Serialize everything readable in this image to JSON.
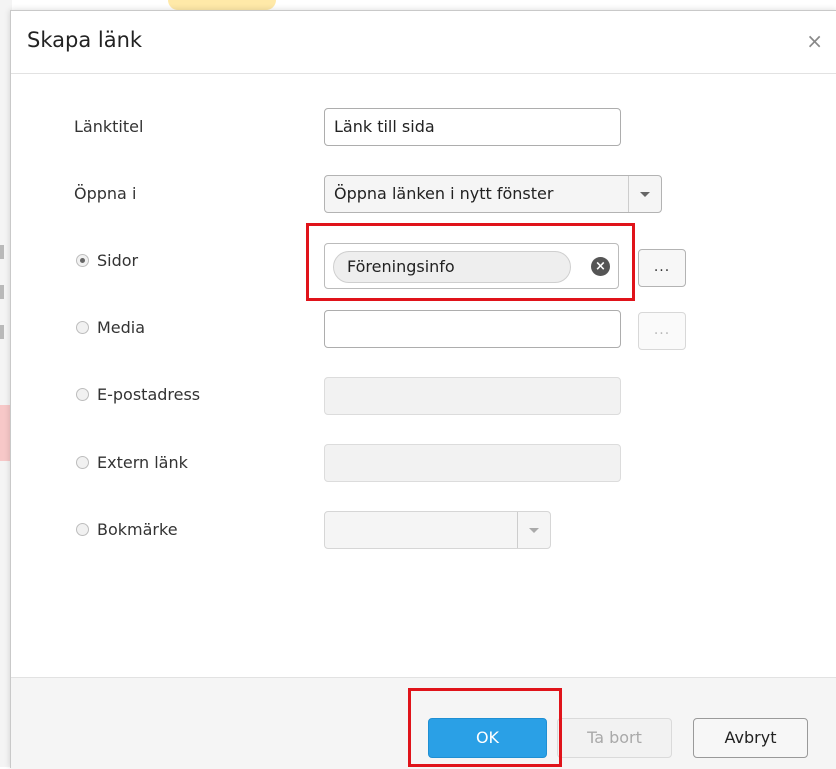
{
  "dialog": {
    "title": "Skapa länk",
    "close_glyph": "×"
  },
  "form": {
    "link_title": {
      "label": "Länktitel",
      "value": "Länk till sida"
    },
    "open_in": {
      "label": "Öppna i",
      "selected": "Öppna länken i nytt fönster"
    },
    "pages": {
      "label": "Sidor",
      "chip": "Föreningsinfo",
      "browse": "...",
      "checked": true
    },
    "media": {
      "label": "Media",
      "value": "",
      "browse": "..."
    },
    "email": {
      "label": "E-postadress",
      "value": ""
    },
    "external": {
      "label": "Extern länk",
      "value": ""
    },
    "bookmark": {
      "label": "Bokmärke",
      "selected": ""
    }
  },
  "footer": {
    "ok_label": "OK",
    "remove_label": "Ta bort",
    "cancel_label": "Avbryt"
  },
  "icons": {
    "clear": "clear-circle-icon",
    "dropdown": "caret-down-icon"
  },
  "colors": {
    "primary_button": "#2aa0e6",
    "highlight": "#e0131a"
  }
}
